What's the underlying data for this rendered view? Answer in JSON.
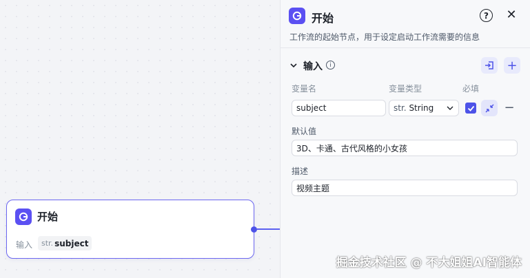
{
  "node": {
    "title": "开始",
    "input_label": "输入",
    "var_type": "str.",
    "var_name": "subject"
  },
  "panel": {
    "title": "开始",
    "description": "工作流的起始节点，用于设定启动工作流需要的信息",
    "help_icon": "question-circle-icon",
    "close_icon": "close-icon",
    "section_title": "输入",
    "columns": {
      "name": "变量名",
      "type": "变量类型",
      "required": "必填"
    },
    "variable": {
      "name": "subject",
      "type_prefix": "str.",
      "type": "String",
      "required": true,
      "default_label": "默认值",
      "default_value": "3D、卡通、古代风格的小女孩",
      "desc_label": "描述",
      "desc_value": "视频主题"
    }
  },
  "watermark": "掘金技术社区 @ 不大姐姐AI智能体",
  "colors": {
    "accent": "#4d53e8",
    "node_icon": "#5b50f2",
    "node_border": "#6b66f0",
    "panel_bg": "#f7f8fa"
  }
}
